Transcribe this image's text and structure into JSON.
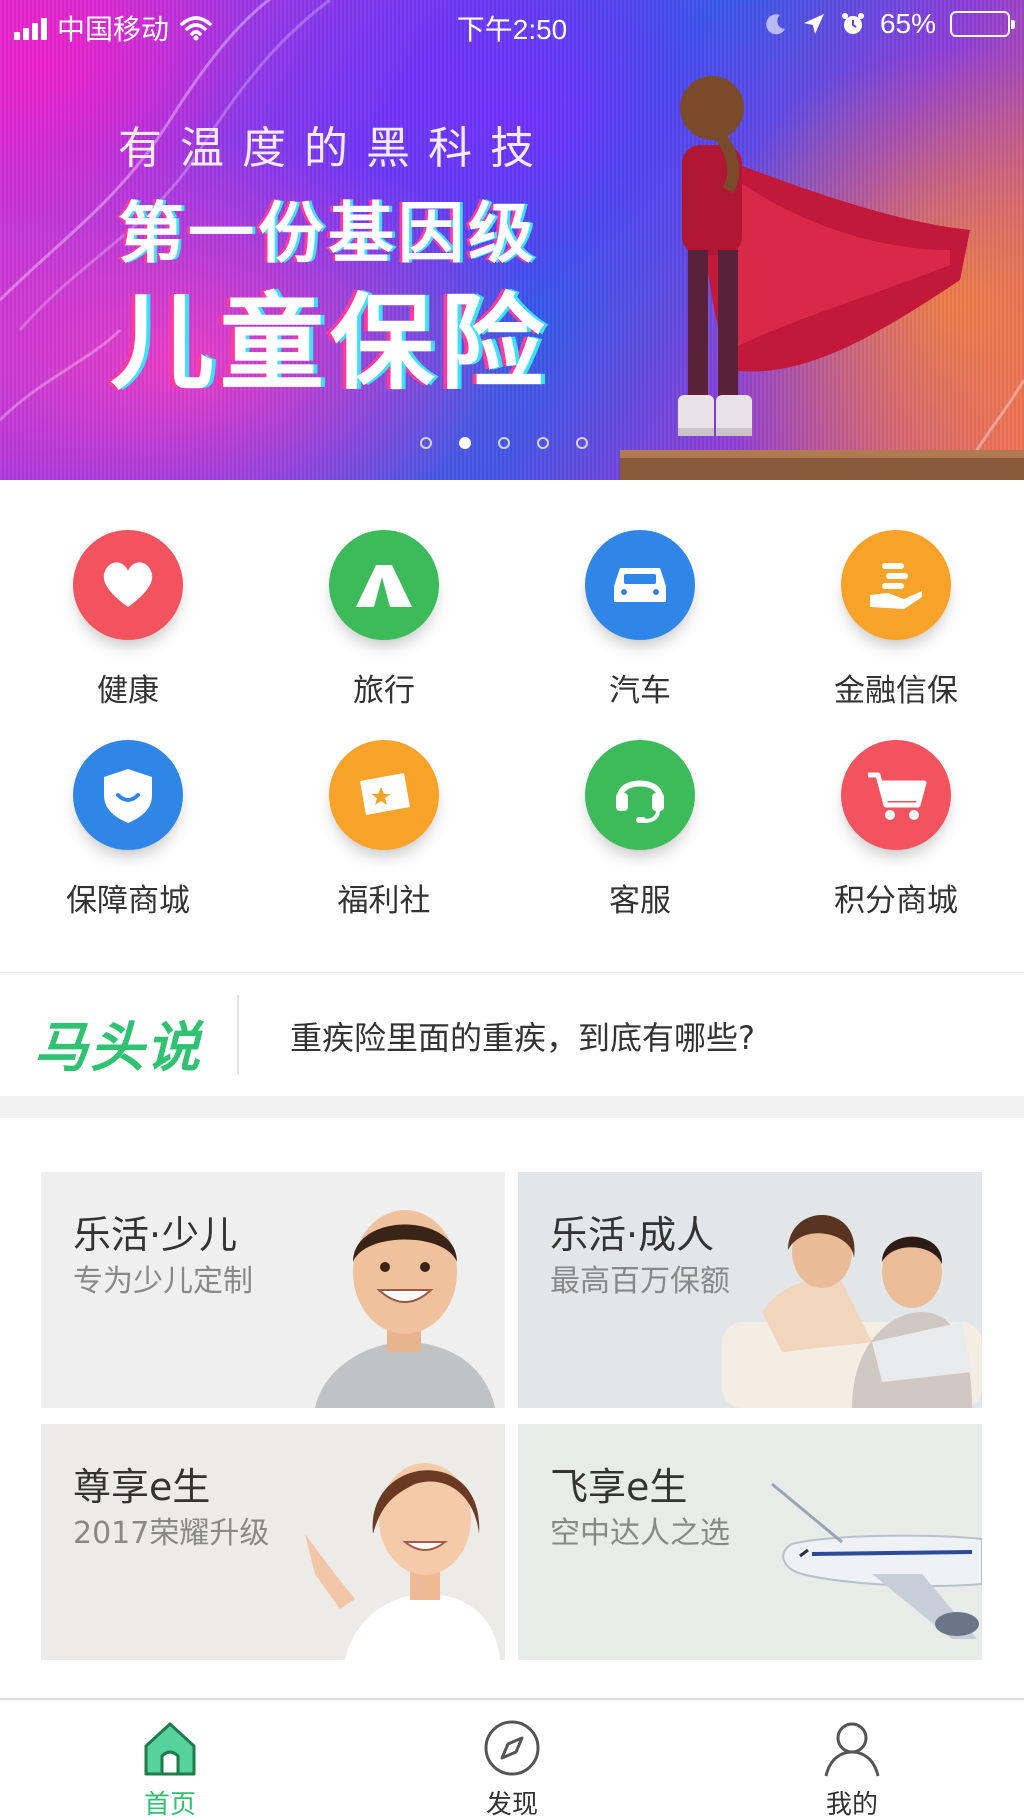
{
  "status_bar": {
    "carrier": "中国移动",
    "time": "下午2:50",
    "battery": "65%",
    "battery_level": 0.65
  },
  "banner": {
    "line1": "有温度的黑科技",
    "line2": "第一份基因级",
    "line3": "儿童保险",
    "slide_count": 5,
    "active_slide": 2
  },
  "categories": [
    {
      "label": "健康",
      "icon": "heart-icon",
      "color": "#f2535e"
    },
    {
      "label": "旅行",
      "icon": "tent-icon",
      "color": "#3dbb5a"
    },
    {
      "label": "汽车",
      "icon": "car-icon",
      "color": "#2f86e6"
    },
    {
      "label": "金融信保",
      "icon": "hand-coins-icon",
      "color": "#f7a229"
    },
    {
      "label": "保障商城",
      "icon": "shield-icon",
      "color": "#2f86e6"
    },
    {
      "label": "福利社",
      "icon": "ticket-icon",
      "color": "#f7a229"
    },
    {
      "label": "客服",
      "icon": "headset-icon",
      "color": "#3dbb5a"
    },
    {
      "label": "积分商城",
      "icon": "cart-icon",
      "color": "#f2535e"
    }
  ],
  "news": {
    "brand": "马头说",
    "headline": "重疾险里面的重疾，到底有哪些?",
    "brand_color": "#2fc271"
  },
  "products": [
    {
      "title": "乐活·少儿",
      "subtitle": "专为少儿定制",
      "image": "smiling-boy",
      "bg": "#efefef"
    },
    {
      "title": "乐活·成人",
      "subtitle": "最高百万保额",
      "image": "couple-laptop",
      "bg": "#e3e6e8"
    },
    {
      "title": "尊享e生",
      "subtitle": "2017荣耀升级",
      "image": "woman-pointing",
      "bg": "#ecebe7"
    },
    {
      "title": "飞享e生",
      "subtitle": "空中达人之选",
      "image": "airplane",
      "bg": "#e8ece8"
    }
  ],
  "tab_bar": {
    "tabs": [
      {
        "label": "首页",
        "icon": "home-icon",
        "active": true
      },
      {
        "label": "发现",
        "icon": "compass-icon",
        "active": false
      },
      {
        "label": "我的",
        "icon": "user-icon",
        "active": false
      }
    ],
    "active_color": "#2fc271"
  }
}
